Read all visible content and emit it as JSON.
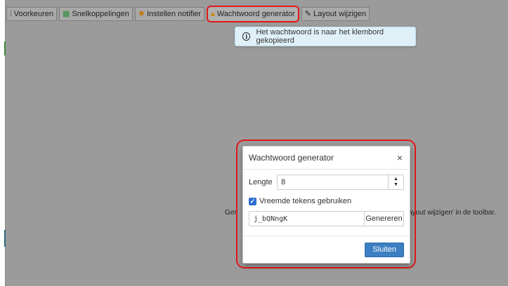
{
  "toolbar": {
    "buttons": [
      {
        "label": "Voorkeuren",
        "icon": "sliders-icon"
      },
      {
        "label": "Snelkoppelingen",
        "icon": "grid-icon"
      },
      {
        "label": "Instellen notifier",
        "icon": "gear-icon"
      },
      {
        "label": "Wachtwoord generator",
        "icon": "lock-icon"
      },
      {
        "label": "Layout wijzigen",
        "icon": "edit-icon"
      }
    ]
  },
  "toast": {
    "message": "Het wachtwoord is naar het klembord gekopieerd",
    "icon": "info-icon"
  },
  "background": {
    "left_text": "Ger",
    "right_text": "ayout wijzigen' in de toolbar."
  },
  "modal": {
    "title": "Wachtwoord generator",
    "length_label": "Lengte",
    "length_value": "8",
    "checkbox_label": "Vreemde tekens gebruiken",
    "checkbox_checked": true,
    "password_value": "j_bQNngK",
    "generate_label": "Genereren",
    "close_label": "Sluiten"
  },
  "colors": {
    "highlight": "#e01818",
    "primary": "#3c7fc2",
    "toast_bg": "#dff0f7"
  }
}
